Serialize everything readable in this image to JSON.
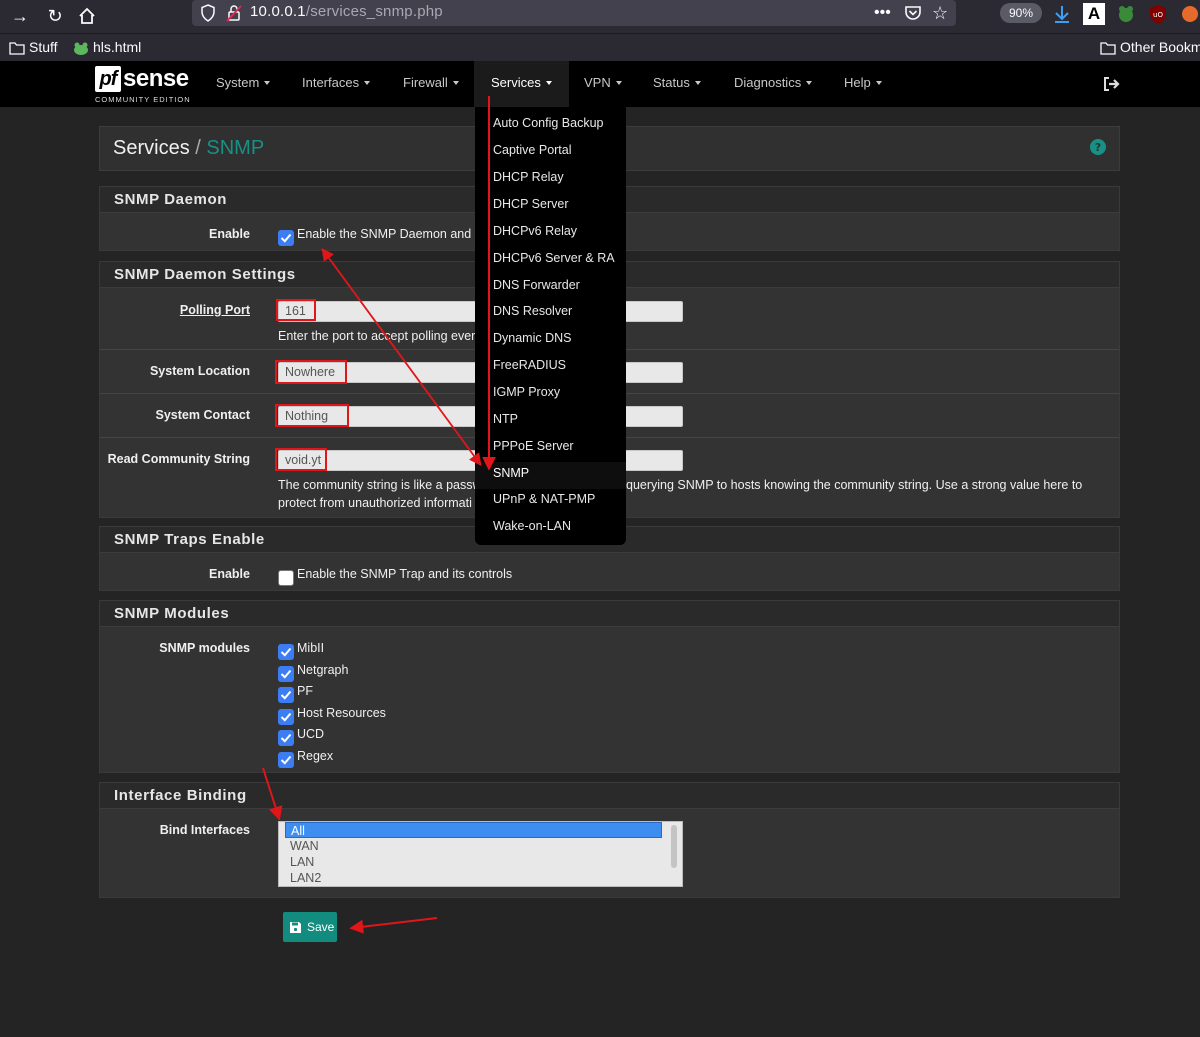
{
  "browser": {
    "url_host": "10.0.0.1",
    "url_path": "/services_snmp.php",
    "zoom": "90%",
    "bookmarks": [
      {
        "label": "Stuff"
      },
      {
        "label": "hls.html"
      }
    ],
    "other_bookmarks": "Other Bookm"
  },
  "nav": {
    "logo_main": "sense",
    "logo_pf": "pf",
    "logo_sub": "COMMUNITY EDITION",
    "items": [
      "System",
      "Interfaces",
      "Firewall",
      "Services",
      "VPN",
      "Status",
      "Diagnostics",
      "Help"
    ],
    "active": "Services"
  },
  "services_menu": [
    "Auto Config Backup",
    "Captive Portal",
    "DHCP Relay",
    "DHCP Server",
    "DHCPv6 Relay",
    "DHCPv6 Server & RA",
    "DNS Forwarder",
    "DNS Resolver",
    "Dynamic DNS",
    "FreeRADIUS",
    "IGMP Proxy",
    "NTP",
    "PPPoE Server",
    "SNMP",
    "UPnP & NAT-PMP",
    "Wake-on-LAN"
  ],
  "breadcrumb": {
    "parent": "Services",
    "separator": "/",
    "current": "SNMP"
  },
  "daemon": {
    "title": "SNMP Daemon",
    "enable_label": "Enable",
    "enable_text": "Enable the SNMP Daemon and it",
    "enabled": true
  },
  "settings": {
    "title": "SNMP Daemon Settings",
    "polling_port_label": "Polling Port",
    "polling_port_value": "161",
    "polling_port_help": "Enter the port to accept polling ever",
    "location_label": "System Location",
    "location_value": "Nowhere",
    "contact_label": "System Contact",
    "contact_value": "Nothing",
    "community_label": "Read Community String",
    "community_value": "void.yt",
    "community_help_1a": "The community string is like a passw",
    "community_help_1b": "querying SNMP to hosts knowing the community string. Use a strong value here to",
    "community_help_2": "protect from unauthorized informati"
  },
  "traps": {
    "title": "SNMP Traps Enable",
    "enable_label": "Enable",
    "enable_text": "Enable the SNMP Trap and its controls",
    "enabled": false
  },
  "modules": {
    "title": "SNMP Modules",
    "label": "SNMP modules",
    "items": [
      {
        "name": "MibII",
        "checked": true
      },
      {
        "name": "Netgraph",
        "checked": true
      },
      {
        "name": "PF",
        "checked": true
      },
      {
        "name": "Host Resources",
        "checked": true
      },
      {
        "name": "UCD",
        "checked": true
      },
      {
        "name": "Regex",
        "checked": true
      }
    ]
  },
  "binding": {
    "title": "Interface Binding",
    "label": "Bind Interfaces",
    "options": [
      "All",
      "WAN",
      "LAN",
      "LAN2"
    ],
    "selected": "All"
  },
  "save_label": "Save",
  "colors": {
    "accent": "#179186",
    "annotation": "#e0161b",
    "checkbox": "#3d7df3"
  }
}
